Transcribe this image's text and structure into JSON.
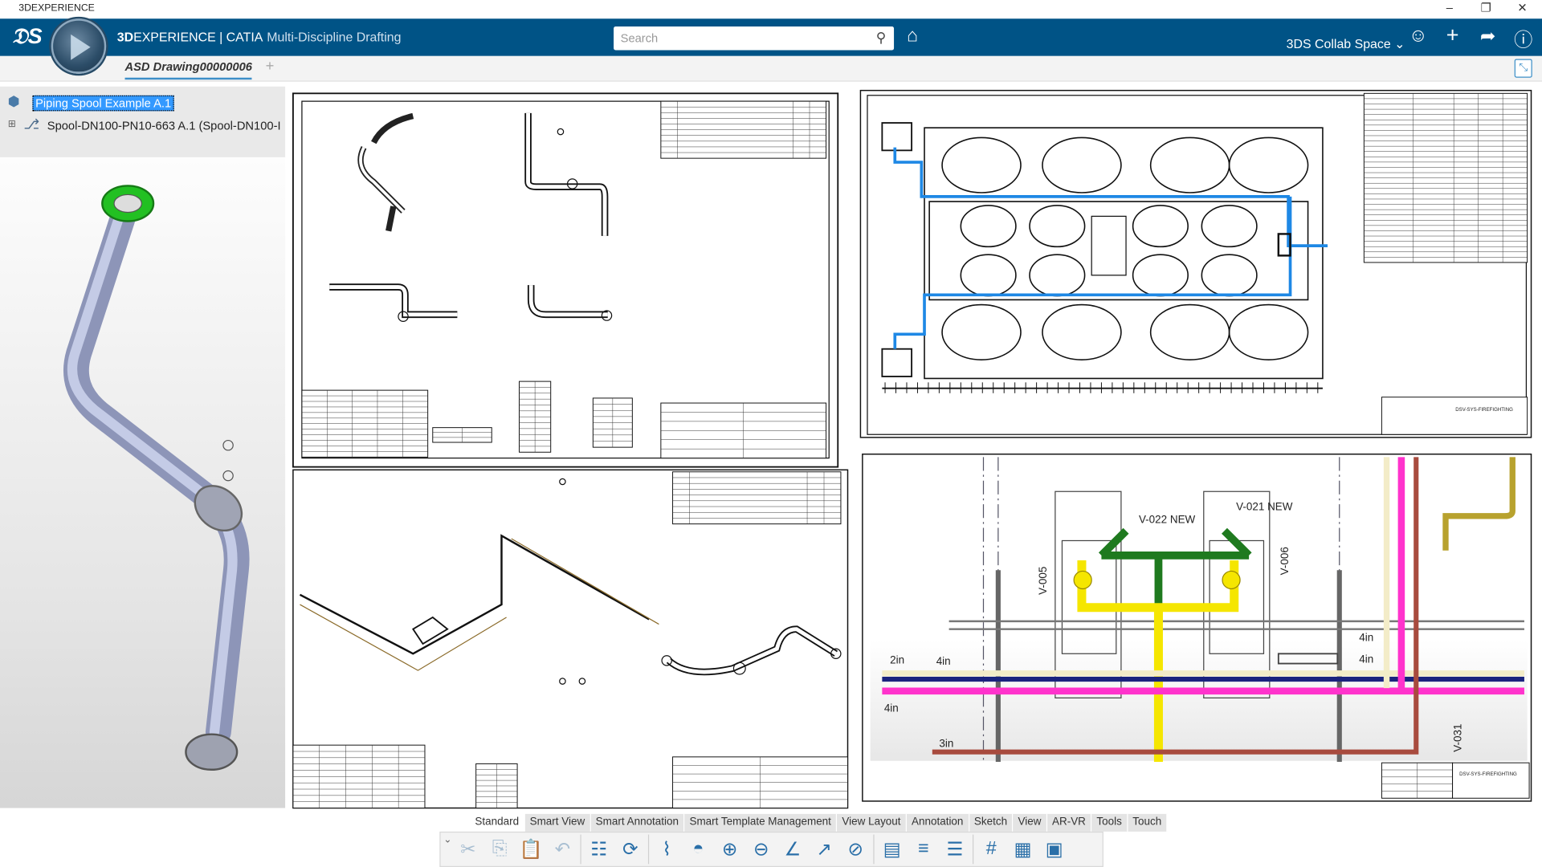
{
  "window": {
    "title": "3DEXPERIENCE",
    "controls": [
      "minimize",
      "restore",
      "close"
    ]
  },
  "header": {
    "brand": "3D",
    "brand_rest": "EXPERIENCE | CATIA",
    "app": "Multi-Discipline Drafting",
    "search_placeholder": "Search",
    "workspace": "3DS Collab Space",
    "accent": "#005386"
  },
  "tabs": {
    "active": "ASD Drawing00000006",
    "add": "+"
  },
  "tree": {
    "root": "Piping Spool Example A.1",
    "child": "Spool-DN100-PN10-663 A.1 (Spool-DN100-I"
  },
  "ribbon": {
    "tabs": [
      "Standard",
      "Smart View",
      "Smart Annotation",
      "Smart Template Management",
      "View Layout",
      "Annotation",
      "Sketch",
      "View",
      "AR-VR",
      "Tools",
      "Touch"
    ],
    "active": "Standard",
    "tools": [
      {
        "icon": "cut-icon",
        "g": "✂",
        "dis": true
      },
      {
        "icon": "copy-icon",
        "g": "⎘",
        "dis": true
      },
      {
        "icon": "paste-icon",
        "g": "📋",
        "dis": true
      },
      {
        "icon": "undo-icon",
        "g": "↶",
        "dis": true
      },
      {
        "sep": true
      },
      {
        "icon": "properties-icon",
        "g": "☷"
      },
      {
        "icon": "update-icon",
        "g": "⟳"
      },
      {
        "sep": true
      },
      {
        "icon": "pipe-view-icon",
        "g": "⌇"
      },
      {
        "icon": "section-view-icon",
        "g": "◓"
      },
      {
        "icon": "add-view-icon",
        "g": "⊕"
      },
      {
        "icon": "projection-view-icon",
        "g": "⊖"
      },
      {
        "icon": "angle-icon",
        "g": "∠"
      },
      {
        "icon": "leader-icon",
        "g": "↗"
      },
      {
        "icon": "compass-icon",
        "g": "⊘"
      },
      {
        "sep": true
      },
      {
        "icon": "sheet-icon",
        "g": "▤"
      },
      {
        "icon": "dimension-icon",
        "g": "≡"
      },
      {
        "icon": "table-icon",
        "g": "☰"
      },
      {
        "sep": true
      },
      {
        "icon": "grid-icon",
        "g": "#"
      },
      {
        "icon": "frame-icon",
        "g": "▦"
      },
      {
        "icon": "title-block-icon",
        "g": "▣"
      }
    ]
  },
  "drawings": {
    "valves": [
      "V-022 NEW",
      "V-021 NEW",
      "V-005",
      "V-006",
      "V-031"
    ],
    "sizes": [
      "2in",
      "4in",
      "4in",
      "4in",
      "4in",
      "3in"
    ],
    "title_block": "DSV-SYS-FIREFIGHTING"
  },
  "colors": {
    "pipe_yellow": "#f5e600",
    "pipe_green": "#1f7a1f",
    "pipe_magenta": "#ff33cc",
    "pipe_navy": "#1a237e",
    "pipe_brown": "#a84b3e",
    "pipe_beige": "#f3ecc8",
    "pipe_gold": "#b8a22e",
    "route_blue": "#1e88e5",
    "flange_green": "#22c022"
  }
}
